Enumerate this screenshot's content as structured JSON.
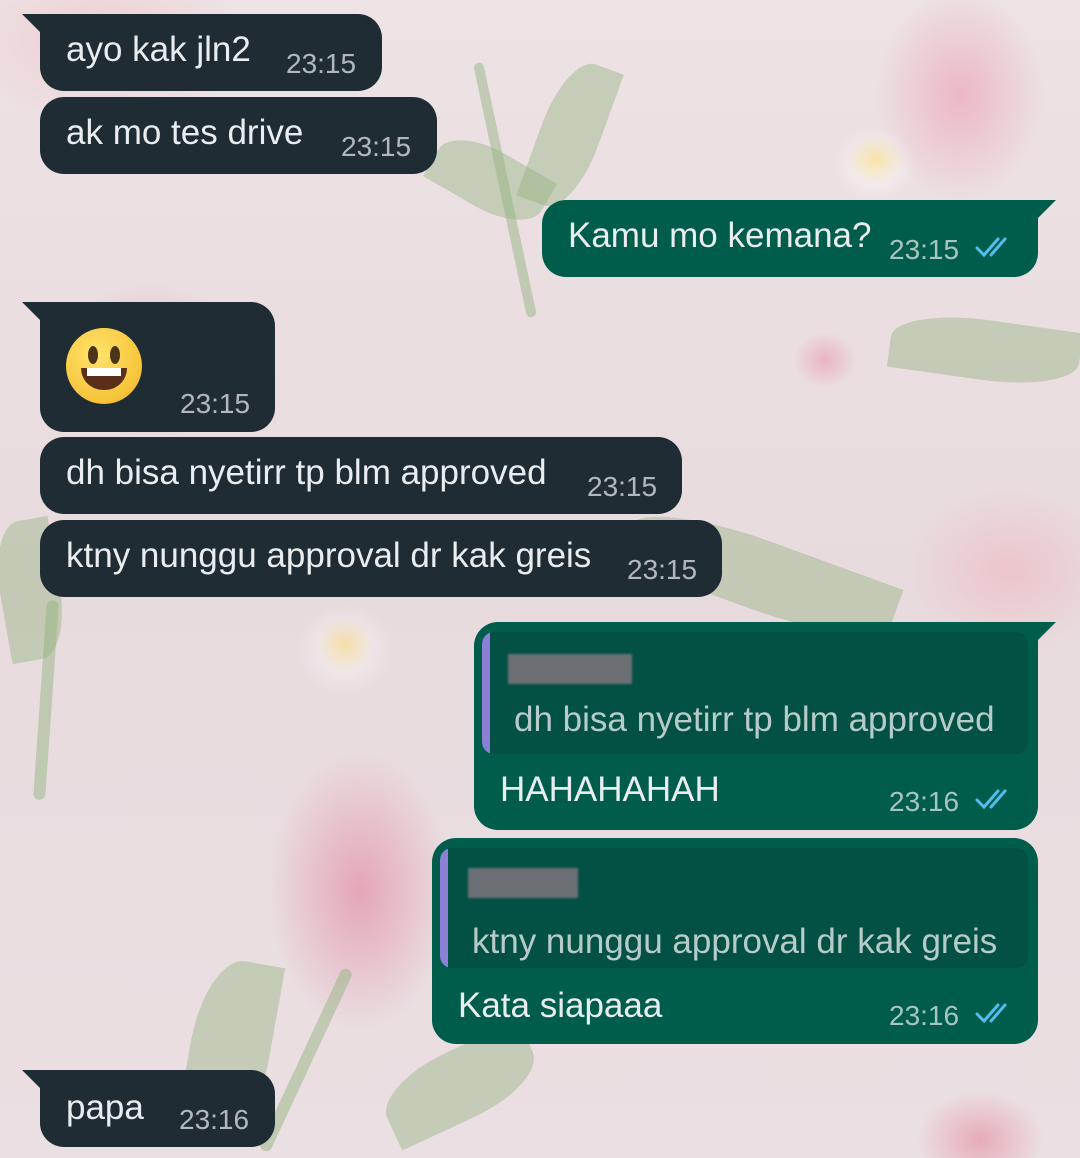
{
  "messages": [
    {
      "text": "ayo kak jln2",
      "time": "23:15"
    },
    {
      "text": "ak mo tes drive",
      "time": "23:15"
    },
    {
      "text": "Kamu mo kemana?",
      "time": "23:15"
    },
    {
      "emoji": "grinning-face",
      "time": "23:15"
    },
    {
      "text": "dh bisa nyetirr tp blm approved",
      "time": "23:15"
    },
    {
      "text": "ktny nunggu approval dr kak greis",
      "time": "23:15"
    },
    {
      "quote": "dh bisa nyetirr tp blm approved",
      "text": "HAHAHAHAH",
      "time": "23:16"
    },
    {
      "quote": "ktny nunggu approval dr kak greis",
      "text": "Kata siapaaa",
      "time": "23:16"
    },
    {
      "text": "papa",
      "time": "23:16"
    }
  ],
  "colors": {
    "incoming_bubble": "#202c33",
    "outgoing_bubble": "#005c4b",
    "quote_bar": "#8b7fd6",
    "read_ticks": "#53bdeb"
  },
  "icons": {
    "read_status": "double-check-icon"
  }
}
